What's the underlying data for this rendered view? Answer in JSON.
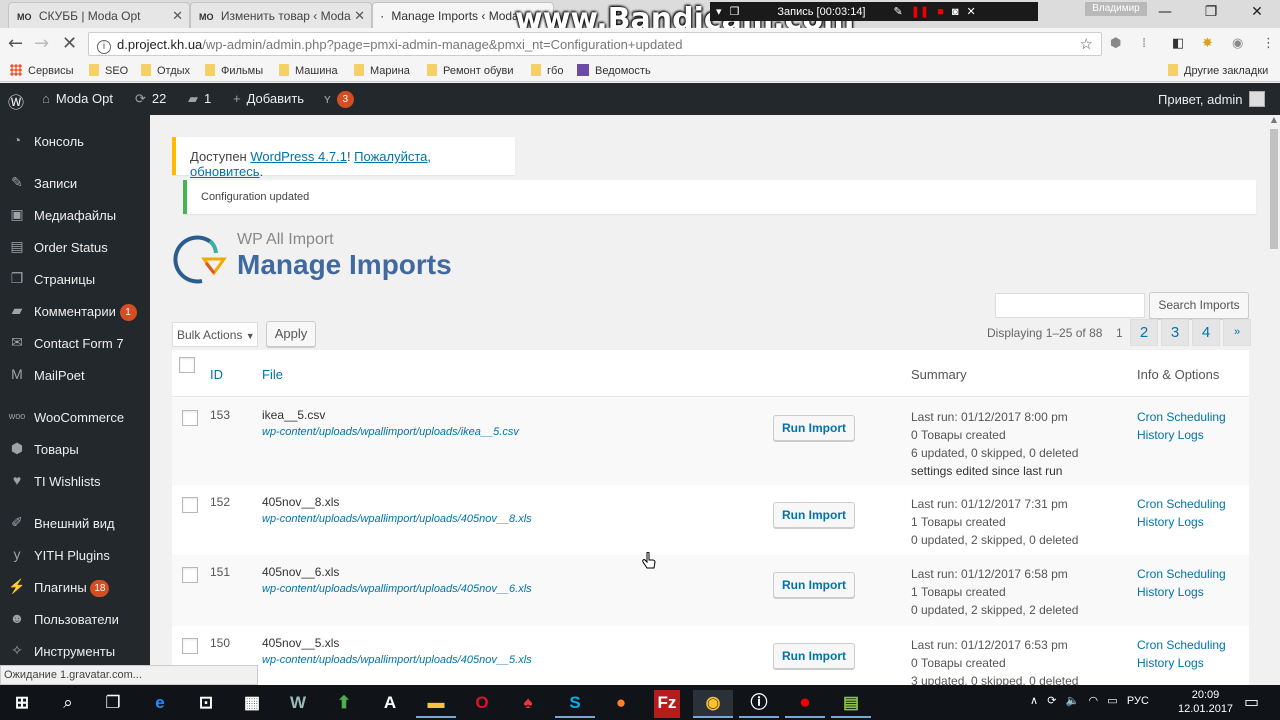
{
  "browser": {
    "tabs": [
      {
        "favicon": "MO",
        "title": "СКУББ | Moda Opt"
      },
      {
        "favicon": "MO",
        "title": "Изменить товар ‹ Moda"
      },
      {
        "favicon": "·",
        "title": "Manage Imports ‹ Moda"
      }
    ],
    "profile_name": "Владимир",
    "window_controls": {
      "minimize": "—",
      "maximize": "❐",
      "close": "✕"
    },
    "url_host": "d.project.kh.ua",
    "url_path": "/wp-admin/admin.php?page=pmxi-admin-manage&pmxi_nt=Configuration+updated",
    "bookmarks": [
      {
        "label": "Сервисы",
        "icon": "apps-icon"
      },
      {
        "label": "SEO",
        "icon": "folder-icon"
      },
      {
        "label": "Отдых",
        "icon": "folder-icon"
      },
      {
        "label": "Фильмы",
        "icon": "folder-icon"
      },
      {
        "label": "Машина",
        "icon": "folder-icon"
      },
      {
        "label": "Марина",
        "icon": "folder-icon"
      },
      {
        "label": "Ремонт обуви",
        "icon": "folder-icon"
      },
      {
        "label": "гбо",
        "icon": "folder-icon"
      },
      {
        "label": "Ведомость",
        "icon": "sheets-icon"
      }
    ],
    "other_bookmarks": "Другие закладки",
    "status_text": "Ожидание 1.gravatar.com..."
  },
  "recorder": {
    "watermark": "www.Bandicam.com",
    "status": "Запись [00:03:14]"
  },
  "adminbar": {
    "site_name": "Moda Opt",
    "updates_count": "22",
    "comments_count": "1",
    "add_new": "Добавить",
    "yoast_badge": "3",
    "greeting": "Привет, admin"
  },
  "sidebar": {
    "items": [
      {
        "label": "Консоль",
        "icon": "dashboard-icon"
      },
      {
        "label": "Записи",
        "icon": "pin-icon"
      },
      {
        "label": "Медиафайлы",
        "icon": "media-icon"
      },
      {
        "label": "Order Status",
        "icon": "order-status-icon"
      },
      {
        "label": "Страницы",
        "icon": "pages-icon"
      },
      {
        "label": "Комментарии",
        "icon": "comments-icon",
        "badge": "1"
      },
      {
        "label": "Contact Form 7",
        "icon": "mail-icon"
      },
      {
        "label": "MailPoet",
        "icon": "mailpoet-icon"
      },
      {
        "label": "WooCommerce",
        "icon": "woo-icon"
      },
      {
        "label": "Товары",
        "icon": "box-icon"
      },
      {
        "label": "TI Wishlists",
        "icon": "heart-icon"
      },
      {
        "label": "Внешний вид",
        "icon": "brush-icon"
      },
      {
        "label": "YITH Plugins",
        "icon": "yith-icon"
      },
      {
        "label": "Плагины",
        "icon": "plugin-icon",
        "badge": "18"
      },
      {
        "label": "Пользователи",
        "icon": "user-icon"
      },
      {
        "label": "Инструменты",
        "icon": "wrench-icon"
      }
    ]
  },
  "notices": {
    "update_prefix": "Доступен ",
    "update_link": "WordPress 4.7.1",
    "update_mid": "! ",
    "update_cta": "Пожалуйста, обновитесь",
    "update_suffix": ".",
    "config_updated": "Configuration updated"
  },
  "page": {
    "plugin_name": "WP All Import",
    "title": "Manage Imports",
    "search_placeholder": "",
    "search_button": "Search Imports",
    "bulk_actions": "Bulk Actions",
    "apply": "Apply",
    "pager_info": "Displaying 1–25 of 88",
    "current_page": "1",
    "pages": [
      "2",
      "3",
      "4",
      "»"
    ]
  },
  "table": {
    "headers": {
      "id": "ID",
      "file": "File",
      "summary": "Summary",
      "info": "Info & Options"
    },
    "rows": [
      {
        "id": "153",
        "file": "ikea__5.csv",
        "path": "wp-content/uploads/wpallimport/uploads/ikea__5.csv",
        "action": "Run Import",
        "summary": [
          "Last run: 01/12/2017 8:00 pm",
          "0 Товары created",
          "6 updated, 0 skipped, 0 deleted"
        ],
        "note": "settings edited since last run",
        "links": [
          "Cron Scheduling",
          "History Logs"
        ]
      },
      {
        "id": "152",
        "file": "405nov__8.xls",
        "path": "wp-content/uploads/wpallimport/uploads/405nov__8.xls",
        "action": "Run Import",
        "summary": [
          "Last run: 01/12/2017 7:31 pm",
          "1 Товары created",
          "0 updated, 2 skipped, 0 deleted"
        ],
        "links": [
          "Cron Scheduling",
          "History Logs"
        ]
      },
      {
        "id": "151",
        "file": "405nov__6.xls",
        "path": "wp-content/uploads/wpallimport/uploads/405nov__6.xls",
        "action": "Run Import",
        "summary": [
          "Last run: 01/12/2017 6:58 pm",
          "1 Товары created",
          "0 updated, 2 skipped, 2 deleted"
        ],
        "links": [
          "Cron Scheduling",
          "History Logs"
        ]
      },
      {
        "id": "150",
        "file": "405nov__5.xls",
        "path": "wp-content/uploads/wpallimport/uploads/405nov__5.xls",
        "action": "Run Import",
        "summary": [
          "Last run: 01/12/2017 6:53 pm",
          "0 Товары created",
          "3 updated, 0 skipped, 0 deleted"
        ],
        "links": [
          "Cron Scheduling",
          "History Logs"
        ]
      }
    ]
  },
  "taskbar": {
    "language": "РУС",
    "time": "20:09",
    "date": "12.01.2017"
  },
  "colors": {
    "admin_dark": "#23282d",
    "link_blue": "#0073aa",
    "title_blue": "#40699f",
    "badge_orange": "#d54e21",
    "notice_warning": "#ffb900",
    "notice_success": "#46b450"
  }
}
